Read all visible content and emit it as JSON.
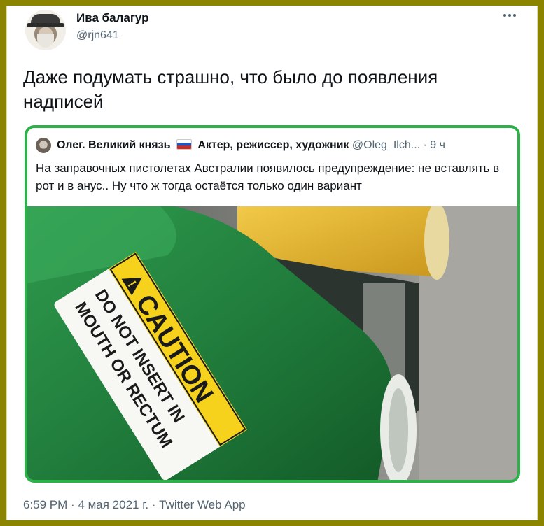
{
  "tweet": {
    "author_name": "Ива балагур",
    "author_handle": "@rjn641",
    "more_icon": "more-horizontal-icon",
    "text": "Даже подумать страшно, что было до появления надписей",
    "timestamp": "6:59 PM · 4 мая 2021 г. · Twitter Web App"
  },
  "quoted_tweet": {
    "author_name": "Олег. Великий князь",
    "flag": "russia-flag-icon",
    "author_bio": "Актер, режиссер, художник",
    "author_handle": "@Oleg_Ilch...",
    "time": "· 9 ч",
    "text": "На заправочных пистолетах Австралии появилось предупреждение: не вставлять в рот и в анус.. Ну что ж тогда остаётся только один вариант",
    "image": {
      "caution_label": "CAUTION",
      "warning_line1": "DO NOT INSERT IN",
      "warning_line2": "MOUTH OR RECTUM"
    }
  },
  "colors": {
    "frame": "#8a8400",
    "quote_border": "#2db24a",
    "nozzle_green": "#1f7a3a",
    "nozzle_yellow": "#e7b52a",
    "caution_yellow": "#f6d21c"
  }
}
